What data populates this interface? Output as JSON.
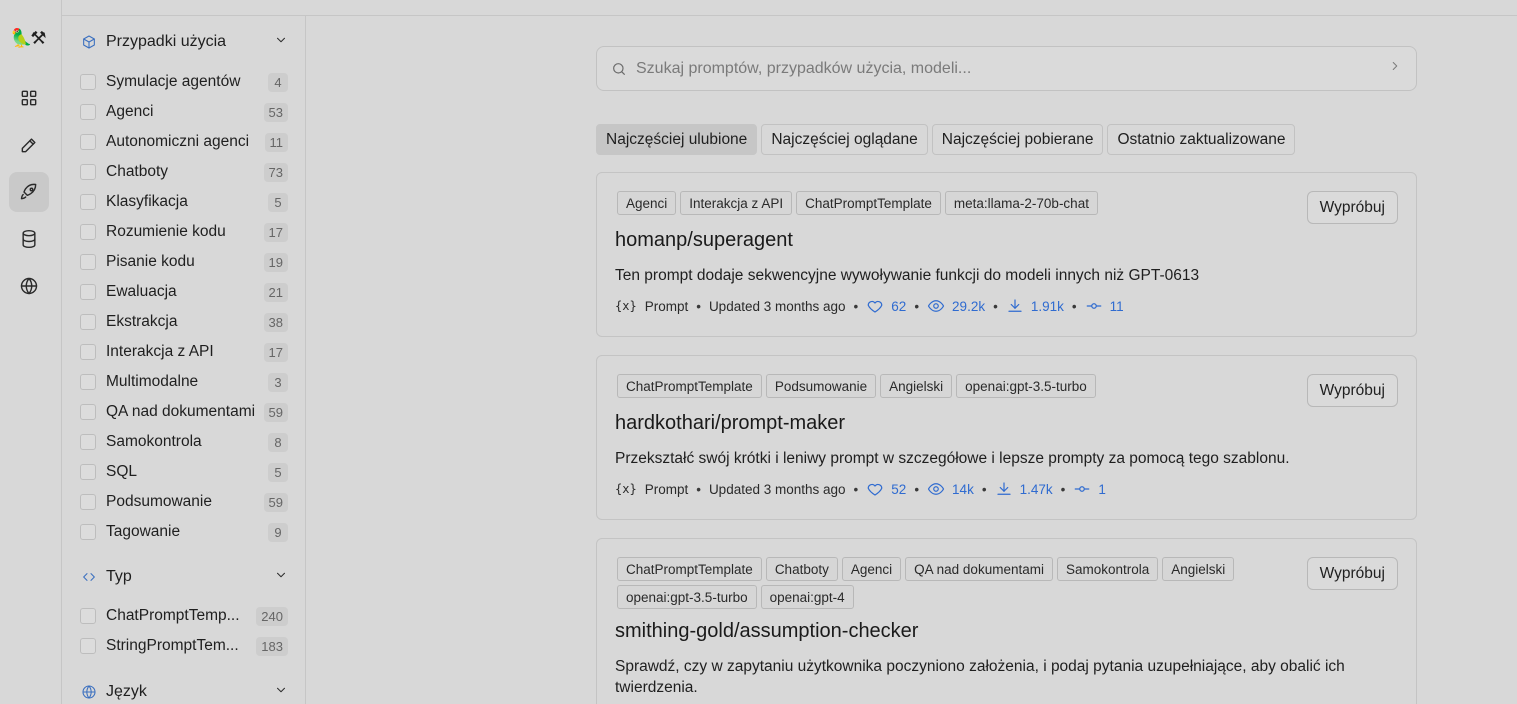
{
  "rail": {
    "logo": "🦜⚒"
  },
  "filters": {
    "use_cases": {
      "title": "Przypadki użycia",
      "items": [
        {
          "label": "Symulacje agentów",
          "count": "4"
        },
        {
          "label": "Agenci",
          "count": "53"
        },
        {
          "label": "Autonomiczni agenci",
          "count": "11"
        },
        {
          "label": "Chatboty",
          "count": "73"
        },
        {
          "label": "Klasyfikacja",
          "count": "5"
        },
        {
          "label": "Rozumienie kodu",
          "count": "17"
        },
        {
          "label": "Pisanie kodu",
          "count": "19"
        },
        {
          "label": "Ewaluacja",
          "count": "21"
        },
        {
          "label": "Ekstrakcja",
          "count": "38"
        },
        {
          "label": "Interakcja z API",
          "count": "17"
        },
        {
          "label": "Multimodalne",
          "count": "3"
        },
        {
          "label": "QA nad dokumentami",
          "count": "59"
        },
        {
          "label": "Samokontrola",
          "count": "8"
        },
        {
          "label": "SQL",
          "count": "5"
        },
        {
          "label": "Podsumowanie",
          "count": "59"
        },
        {
          "label": "Tagowanie",
          "count": "9"
        }
      ]
    },
    "type": {
      "title": "Typ",
      "items": [
        {
          "label": "ChatPromptTemp...",
          "count": "240"
        },
        {
          "label": "StringPromptTem...",
          "count": "183"
        }
      ]
    },
    "language": {
      "title": "Język"
    }
  },
  "search": {
    "placeholder": "Szukaj promptów, przypadków użycia, modeli..."
  },
  "sort_tabs": [
    {
      "label": "Najczęściej ulubione",
      "active": true
    },
    {
      "label": "Najczęściej oglądane",
      "active": false
    },
    {
      "label": "Najczęściej pobierane",
      "active": false
    },
    {
      "label": "Ostatnio zaktualizowane",
      "active": false
    }
  ],
  "try_label": "Wypróbuj",
  "cards": [
    {
      "tags": [
        "Agenci",
        "Interakcja z API",
        "ChatPromptTemplate",
        "meta:llama-2-70b-chat"
      ],
      "title": "homanp/superagent",
      "description": "Ten prompt dodaje sekwencyjne wywoływanie funkcji do modeli innych niż GPT-0613",
      "kind": "Prompt",
      "updated": "Updated 3 months ago",
      "likes": "62",
      "views": "29.2k",
      "downloads": "1.91k",
      "commits": "11"
    },
    {
      "tags": [
        "ChatPromptTemplate",
        "Podsumowanie",
        "Angielski",
        "openai:gpt-3.5-turbo"
      ],
      "title": "hardkothari/prompt-maker",
      "description": "Przekształć swój krótki i leniwy prompt w szczegółowe i lepsze prompty za pomocą tego szablonu.",
      "kind": "Prompt",
      "updated": "Updated 3 months ago",
      "likes": "52",
      "views": "14k",
      "downloads": "1.47k",
      "commits": "1"
    },
    {
      "tags": [
        "ChatPromptTemplate",
        "Chatboty",
        "Agenci",
        "QA nad dokumentami",
        "Samokontrola",
        "Angielski",
        "openai:gpt-3.5-turbo",
        "openai:gpt-4"
      ],
      "title": "smithing-gold/assumption-checker",
      "description": "Sprawdź, czy w zapytaniu użytkownika poczyniono założenia, i podaj pytania uzupełniające, aby obalić ich twierdzenia."
    }
  ]
}
